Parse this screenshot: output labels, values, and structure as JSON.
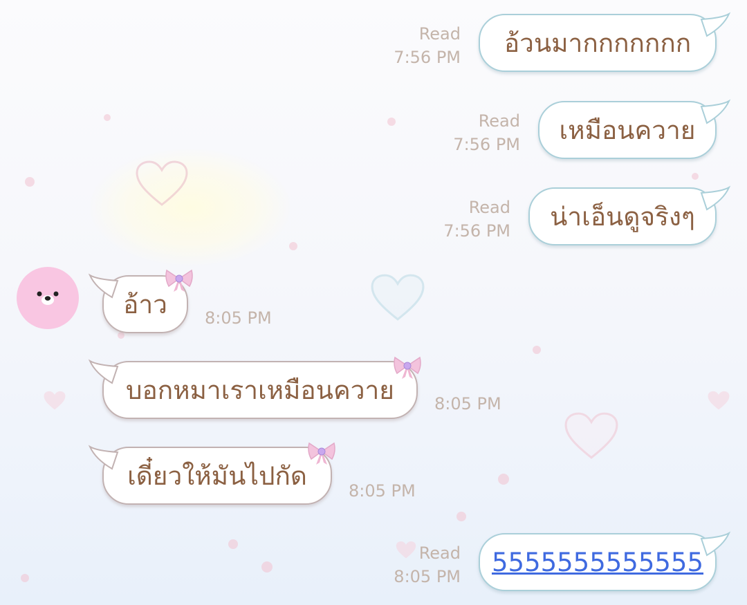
{
  "messages": {
    "out_1": {
      "text": "อ้วนมากกกกกกก",
      "status": "Read",
      "time": "7:56 PM"
    },
    "out_2": {
      "text": "เหมือนควาย",
      "status": "Read",
      "time": "7:56 PM"
    },
    "out_3": {
      "text": "น่าเอ็นดูจริงๆ",
      "status": "Read",
      "time": "7:56 PM"
    },
    "in_1": {
      "text": "อ้าว",
      "time": "8:05 PM"
    },
    "in_2": {
      "text": "บอกหมาเราเหมือนควาย",
      "time": "8:05 PM"
    },
    "in_3": {
      "text": "เดี๋ยวให้มันไปกัด",
      "time": "8:05 PM"
    },
    "out_4": {
      "text": "5555555555555",
      "status": "Read",
      "time": "8:05 PM"
    }
  },
  "colors": {
    "text": "#8b6042",
    "link": "#3f6ae0",
    "outgoing_border": "#aacfd9",
    "incoming_border": "#c2b2b2",
    "meta": "#c4b4aa",
    "avatar": "#f9c6e2"
  },
  "icons": {
    "avatar": "bear-face-avatar",
    "bubble_decoration": "bow-ribbon-icon",
    "background": "heart-icon"
  }
}
